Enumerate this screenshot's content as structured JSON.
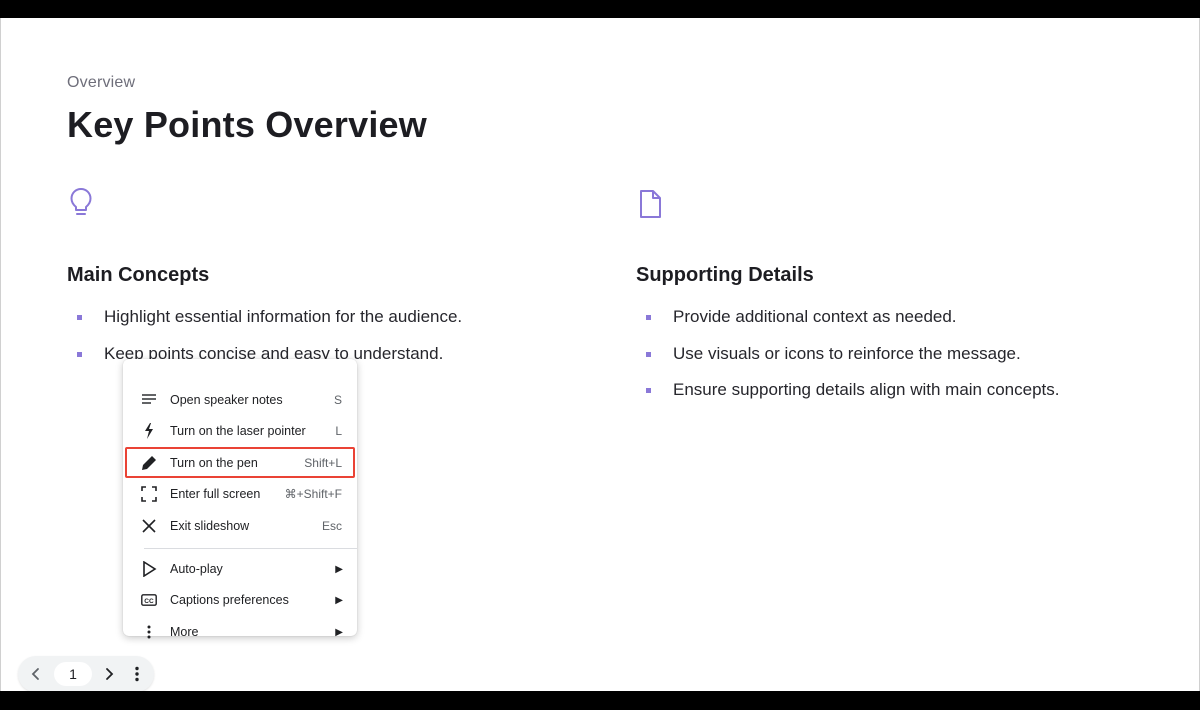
{
  "slide": {
    "eyebrow": "Overview",
    "title": "Key Points Overview",
    "accent_color": "#8a78d8",
    "columns": [
      {
        "icon": "lightbulb-icon",
        "title": "Main Concepts",
        "bullets": [
          "Highlight essential information for the audience.",
          "Keep points concise and easy to understand."
        ]
      },
      {
        "icon": "document-icon",
        "title": "Supporting Details",
        "bullets": [
          "Provide additional context as needed.",
          "Use visuals or icons to reinforce the message.",
          "Ensure supporting details align with main concepts."
        ]
      }
    ]
  },
  "menu": {
    "items": [
      {
        "label": "Open speaker notes",
        "shortcut": "S",
        "icon": "notes-icon"
      },
      {
        "label": "Turn on the laser pointer",
        "shortcut": "L",
        "icon": "laser-pointer-icon"
      },
      {
        "label": "Turn on the pen",
        "shortcut": "Shift+L",
        "icon": "pen-icon"
      },
      {
        "label": "Enter full screen",
        "shortcut": "⌘+Shift+F",
        "icon": "fullscreen-icon"
      },
      {
        "label": "Exit slideshow",
        "shortcut": "Esc",
        "icon": "close-icon"
      },
      {
        "label": "Auto-play",
        "shortcut": "▶",
        "icon": "play-icon"
      },
      {
        "label": "Captions preferences",
        "shortcut": "▶",
        "icon": "captions-icon"
      },
      {
        "label": "More",
        "shortcut": "▶",
        "icon": "more-vertical-icon"
      }
    ],
    "highlight_color": "#ea4335"
  },
  "nav": {
    "page_number": "1"
  }
}
